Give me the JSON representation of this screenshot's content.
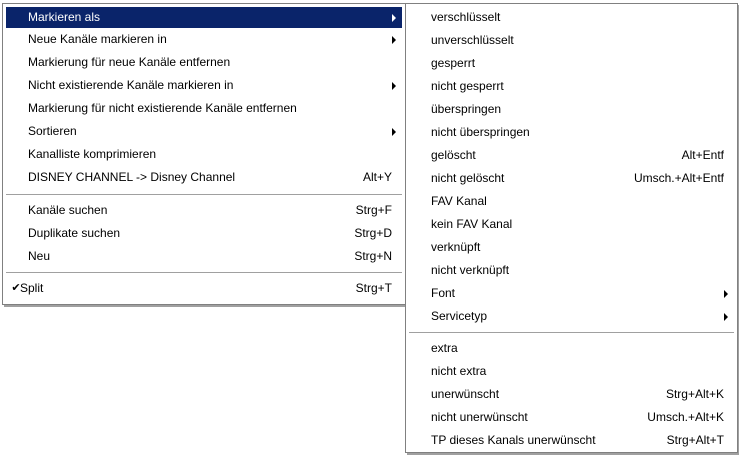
{
  "colors": {
    "highlight_bg": "#0a246a",
    "highlight_text": "#ffffff",
    "border": "#808080",
    "separator": "#a0a0a0"
  },
  "main_menu": {
    "items": [
      {
        "label": "Markieren als",
        "shortcut": "",
        "submenu": true,
        "highlighted": true
      },
      {
        "label": "Neue Kanäle markieren in",
        "shortcut": "",
        "submenu": true
      },
      {
        "label": "Markierung für neue Kanäle entfernen",
        "shortcut": "",
        "submenu": false
      },
      {
        "label": "Nicht existierende Kanäle markieren in",
        "shortcut": "",
        "submenu": true
      },
      {
        "label": "Markierung für nicht existierende Kanäle entfernen",
        "shortcut": "",
        "submenu": false
      },
      {
        "label": "Sortieren",
        "shortcut": "",
        "submenu": true
      },
      {
        "label": "Kanalliste komprimieren",
        "shortcut": "",
        "submenu": false
      },
      {
        "label": "DISNEY CHANNEL -> Disney Channel",
        "shortcut": "Alt+Y",
        "submenu": false
      },
      {
        "label": "Kanäle suchen",
        "shortcut": "Strg+F",
        "submenu": false
      },
      {
        "label": "Duplikate suchen",
        "shortcut": "Strg+D",
        "submenu": false
      },
      {
        "label": "Neu",
        "shortcut": "Strg+N",
        "submenu": false
      },
      {
        "label": "Split",
        "shortcut": "Strg+T",
        "submenu": false,
        "checked": true,
        "check_glyph": "✔"
      }
    ]
  },
  "sub_menu": {
    "items": [
      {
        "label": "verschlüsselt",
        "shortcut": ""
      },
      {
        "label": "unverschlüsselt",
        "shortcut": ""
      },
      {
        "label": "gesperrt",
        "shortcut": ""
      },
      {
        "label": "nicht gesperrt",
        "shortcut": ""
      },
      {
        "label": "überspringen",
        "shortcut": ""
      },
      {
        "label": "nicht überspringen",
        "shortcut": ""
      },
      {
        "label": "gelöscht",
        "shortcut": "Alt+Entf"
      },
      {
        "label": "nicht gelöscht",
        "shortcut": "Umsch.+Alt+Entf"
      },
      {
        "label": "FAV Kanal",
        "shortcut": ""
      },
      {
        "label": "kein FAV Kanal",
        "shortcut": ""
      },
      {
        "label": "verknüpft",
        "shortcut": ""
      },
      {
        "label": "nicht verknüpft",
        "shortcut": ""
      },
      {
        "label": "Font",
        "shortcut": "",
        "submenu": true
      },
      {
        "label": "Servicetyp",
        "shortcut": "",
        "submenu": true
      },
      {
        "label": "extra",
        "shortcut": ""
      },
      {
        "label": "nicht extra",
        "shortcut": ""
      },
      {
        "label": "unerwünscht",
        "shortcut": "Strg+Alt+K"
      },
      {
        "label": "nicht unerwünscht",
        "shortcut": "Umsch.+Alt+K"
      },
      {
        "label": "TP dieses Kanals unerwünscht",
        "shortcut": "Strg+Alt+T"
      }
    ]
  }
}
